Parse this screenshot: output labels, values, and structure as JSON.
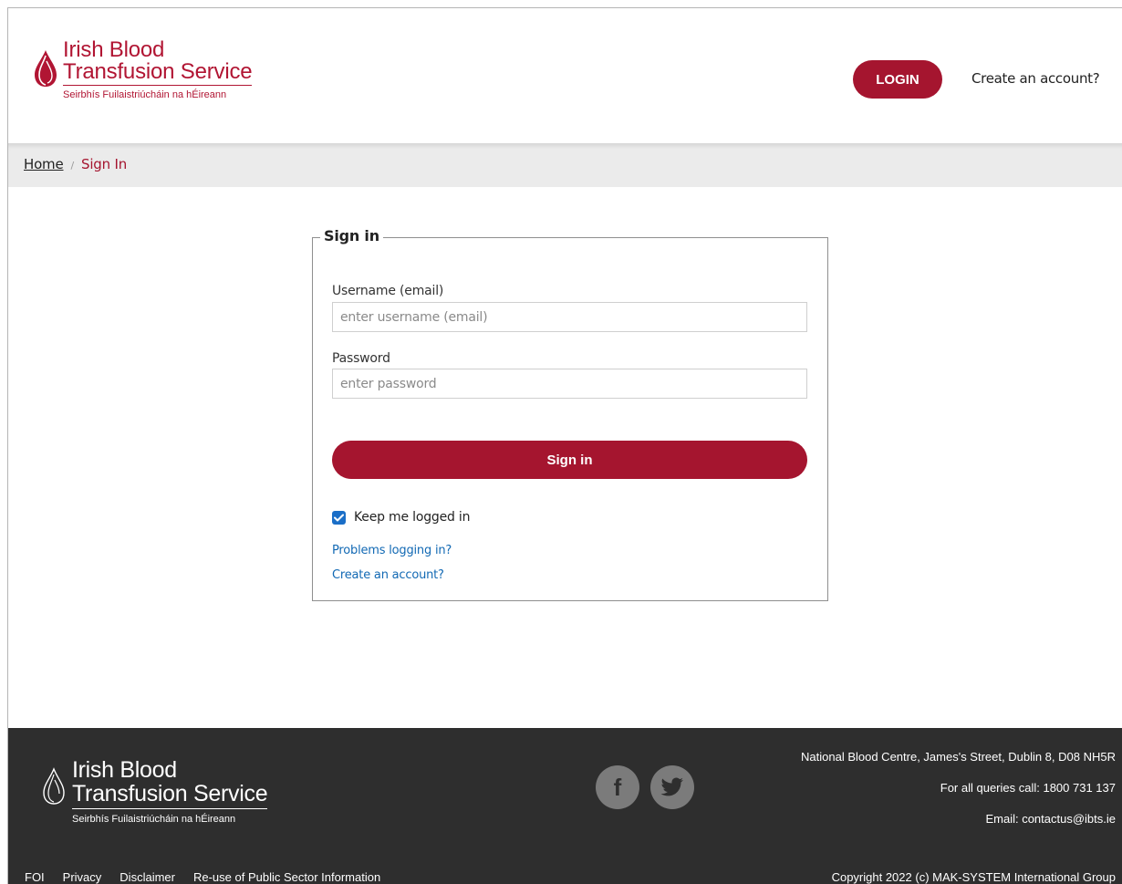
{
  "header": {
    "logo": {
      "line1": "Irish Blood",
      "line2": "Transfusion Service",
      "line3": "Seirbhís Fuilaistriúcháin na hÉireann"
    },
    "login_label": "LOGIN",
    "create_account_label": "Create an account?"
  },
  "breadcrumb": {
    "home": "Home",
    "separator": "/",
    "current": "Sign In"
  },
  "signin": {
    "legend": "Sign in",
    "username_label": "Username (email)",
    "username_placeholder": "enter username (email)",
    "username_value": "",
    "password_label": "Password",
    "password_placeholder": "enter password",
    "password_value": "",
    "submit_label": "Sign in",
    "keep_logged_in_label": "Keep me logged in",
    "keep_logged_in_checked": true,
    "problems_link": "Problems logging in?",
    "create_account_link": "Create an account?"
  },
  "footer": {
    "logo": {
      "line1": "Irish Blood",
      "line2": "Transfusion Service",
      "line3": "Seirbhís Fuilaistriúcháin na hÉireann"
    },
    "social": [
      {
        "icon": "facebook-icon",
        "glyph": "f"
      },
      {
        "icon": "twitter-icon"
      }
    ],
    "address": "National Blood Centre, James's Street, Dublin 8, D08 NH5R",
    "phone": "For all queries call: 1800 731 137",
    "email": "Email: contactus@ibts.ie",
    "links": [
      "FOI",
      "Privacy",
      "Disclaimer",
      "Re-use of Public Sector Information"
    ],
    "copyright": "Copyright 2022 (c) MAK-SYSTEM International Group"
  },
  "colors": {
    "brand_red": "#a5152f",
    "logo_red": "#b11533",
    "link_blue": "#1269b4",
    "footer_bg": "#2e2e2e",
    "breadcrumb_bg": "#ebebeb",
    "checkbox_blue": "#1a6ec7"
  }
}
